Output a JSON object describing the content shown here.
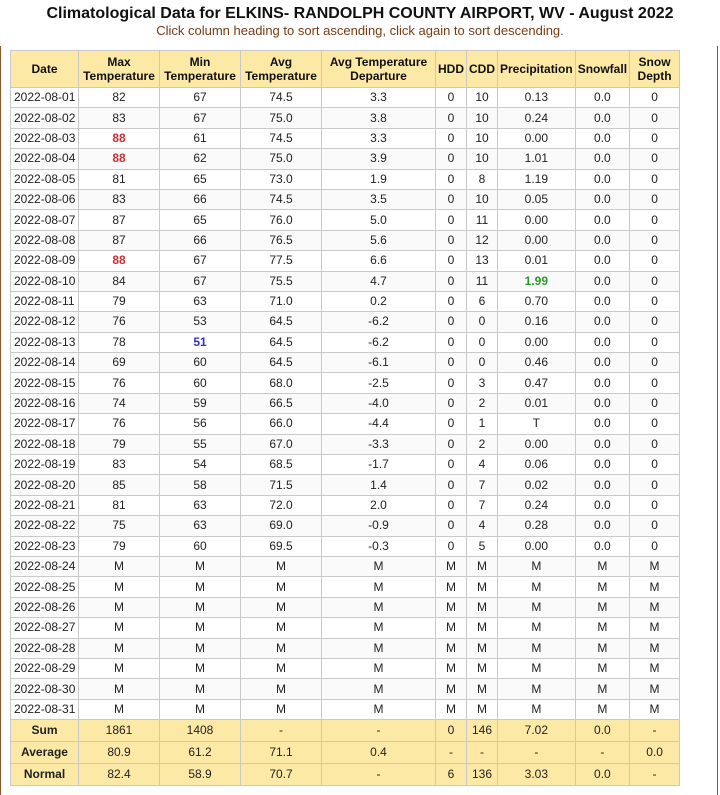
{
  "title": "Climatological Data for ELKINS- RANDOLPH COUNTY AIRPORT, WV - August 2022",
  "subtitle": "Click column heading to sort ascending, click again to sort descending.",
  "columns": [
    "Date",
    "Max Temperature",
    "Min Temperature",
    "Avg Temperature",
    "Avg Temperature Departure",
    "HDD",
    "CDD",
    "Precipitation",
    "Snowfall",
    "Snow Depth"
  ],
  "rows": [
    [
      "2022-08-01",
      "82",
      "67",
      "74.5",
      "3.3",
      "0",
      "10",
      "0.13",
      "0.0",
      "0"
    ],
    [
      "2022-08-02",
      "83",
      "67",
      "75.0",
      "3.8",
      "0",
      "10",
      "0.24",
      "0.0",
      "0"
    ],
    [
      "2022-08-03",
      "88",
      "61",
      "74.5",
      "3.3",
      "0",
      "10",
      "0.00",
      "0.0",
      "0"
    ],
    [
      "2022-08-04",
      "88",
      "62",
      "75.0",
      "3.9",
      "0",
      "10",
      "1.01",
      "0.0",
      "0"
    ],
    [
      "2022-08-05",
      "81",
      "65",
      "73.0",
      "1.9",
      "0",
      "8",
      "1.19",
      "0.0",
      "0"
    ],
    [
      "2022-08-06",
      "83",
      "66",
      "74.5",
      "3.5",
      "0",
      "10",
      "0.05",
      "0.0",
      "0"
    ],
    [
      "2022-08-07",
      "87",
      "65",
      "76.0",
      "5.0",
      "0",
      "11",
      "0.00",
      "0.0",
      "0"
    ],
    [
      "2022-08-08",
      "87",
      "66",
      "76.5",
      "5.6",
      "0",
      "12",
      "0.00",
      "0.0",
      "0"
    ],
    [
      "2022-08-09",
      "88",
      "67",
      "77.5",
      "6.6",
      "0",
      "13",
      "0.01",
      "0.0",
      "0"
    ],
    [
      "2022-08-10",
      "84",
      "67",
      "75.5",
      "4.7",
      "0",
      "11",
      "1.99",
      "0.0",
      "0"
    ],
    [
      "2022-08-11",
      "79",
      "63",
      "71.0",
      "0.2",
      "0",
      "6",
      "0.70",
      "0.0",
      "0"
    ],
    [
      "2022-08-12",
      "76",
      "53",
      "64.5",
      "-6.2",
      "0",
      "0",
      "0.16",
      "0.0",
      "0"
    ],
    [
      "2022-08-13",
      "78",
      "51",
      "64.5",
      "-6.2",
      "0",
      "0",
      "0.00",
      "0.0",
      "0"
    ],
    [
      "2022-08-14",
      "69",
      "60",
      "64.5",
      "-6.1",
      "0",
      "0",
      "0.46",
      "0.0",
      "0"
    ],
    [
      "2022-08-15",
      "76",
      "60",
      "68.0",
      "-2.5",
      "0",
      "3",
      "0.47",
      "0.0",
      "0"
    ],
    [
      "2022-08-16",
      "74",
      "59",
      "66.5",
      "-4.0",
      "0",
      "2",
      "0.01",
      "0.0",
      "0"
    ],
    [
      "2022-08-17",
      "76",
      "56",
      "66.0",
      "-4.4",
      "0",
      "1",
      "T",
      "0.0",
      "0"
    ],
    [
      "2022-08-18",
      "79",
      "55",
      "67.0",
      "-3.3",
      "0",
      "2",
      "0.00",
      "0.0",
      "0"
    ],
    [
      "2022-08-19",
      "83",
      "54",
      "68.5",
      "-1.7",
      "0",
      "4",
      "0.06",
      "0.0",
      "0"
    ],
    [
      "2022-08-20",
      "85",
      "58",
      "71.5",
      "1.4",
      "0",
      "7",
      "0.02",
      "0.0",
      "0"
    ],
    [
      "2022-08-21",
      "81",
      "63",
      "72.0",
      "2.0",
      "0",
      "7",
      "0.24",
      "0.0",
      "0"
    ],
    [
      "2022-08-22",
      "75",
      "63",
      "69.0",
      "-0.9",
      "0",
      "4",
      "0.28",
      "0.0",
      "0"
    ],
    [
      "2022-08-23",
      "79",
      "60",
      "69.5",
      "-0.3",
      "0",
      "5",
      "0.00",
      "0.0",
      "0"
    ],
    [
      "2022-08-24",
      "M",
      "M",
      "M",
      "M",
      "M",
      "M",
      "M",
      "M",
      "M"
    ],
    [
      "2022-08-25",
      "M",
      "M",
      "M",
      "M",
      "M",
      "M",
      "M",
      "M",
      "M"
    ],
    [
      "2022-08-26",
      "M",
      "M",
      "M",
      "M",
      "M",
      "M",
      "M",
      "M",
      "M"
    ],
    [
      "2022-08-27",
      "M",
      "M",
      "M",
      "M",
      "M",
      "M",
      "M",
      "M",
      "M"
    ],
    [
      "2022-08-28",
      "M",
      "M",
      "M",
      "M",
      "M",
      "M",
      "M",
      "M",
      "M"
    ],
    [
      "2022-08-29",
      "M",
      "M",
      "M",
      "M",
      "M",
      "M",
      "M",
      "M",
      "M"
    ],
    [
      "2022-08-30",
      "M",
      "M",
      "M",
      "M",
      "M",
      "M",
      "M",
      "M",
      "M"
    ],
    [
      "2022-08-31",
      "M",
      "M",
      "M",
      "M",
      "M",
      "M",
      "M",
      "M",
      "M"
    ]
  ],
  "highlights": {
    "max_hi": [
      "2022-08-03",
      "2022-08-04",
      "2022-08-09"
    ],
    "min_lo": [
      "2022-08-13"
    ],
    "precip_max": [
      "2022-08-10"
    ]
  },
  "summary": [
    [
      "Sum",
      "1861",
      "1408",
      "-",
      "-",
      "0",
      "146",
      "7.02",
      "0.0",
      "-"
    ],
    [
      "Average",
      "80.9",
      "61.2",
      "71.1",
      "0.4",
      "-",
      "-",
      "-",
      "-",
      "0.0"
    ],
    [
      "Normal",
      "82.4",
      "58.9",
      "70.7",
      "-",
      "6",
      "136",
      "3.03",
      "0.0",
      "-"
    ]
  ],
  "colors": {
    "header_bg": "#fde9a6",
    "high_value": "#c83232",
    "low_value": "#3232c8",
    "precip_max": "#2a9a2a",
    "subtitle": "#7a3a12"
  }
}
